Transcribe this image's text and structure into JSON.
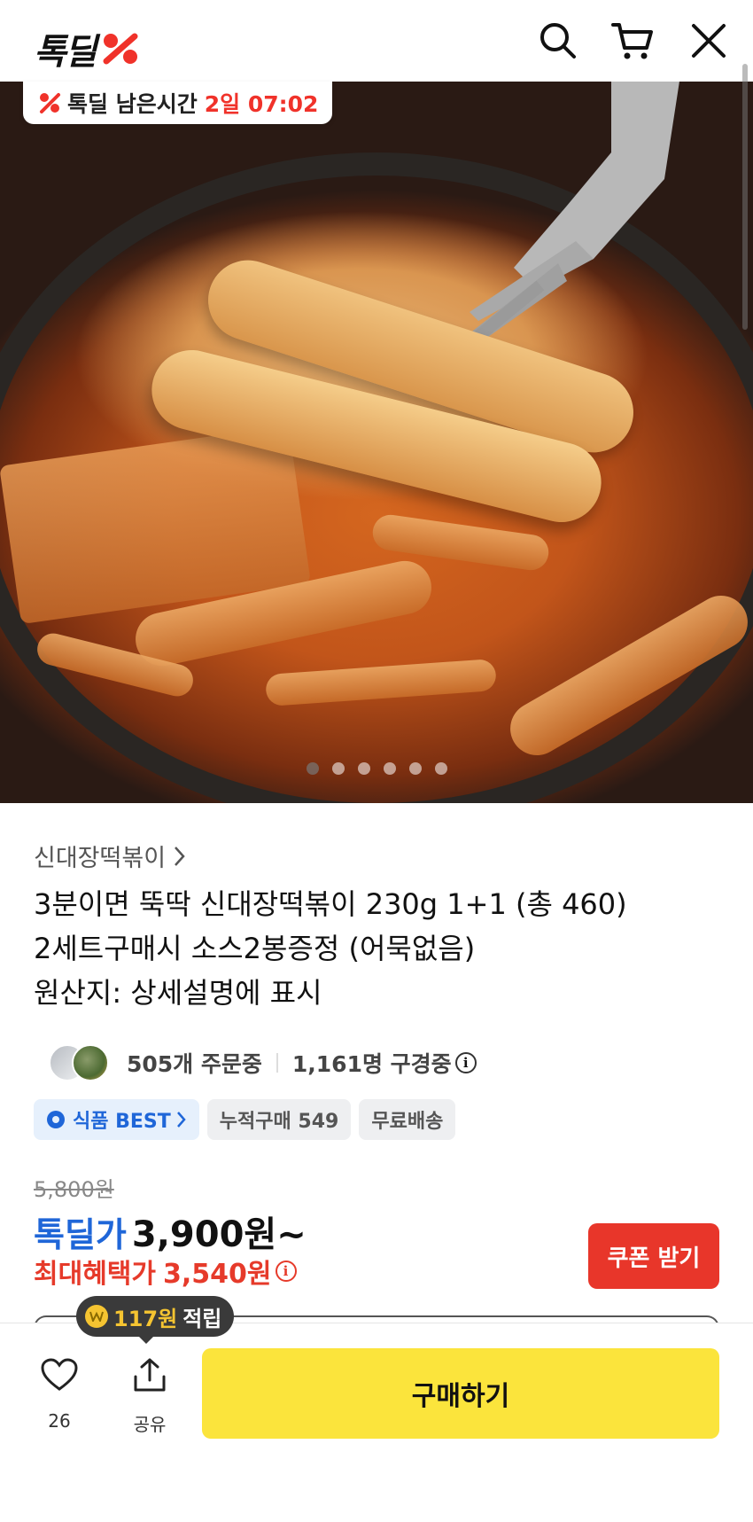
{
  "header": {
    "logo_text": "톡딜",
    "logo_mark": "discount-percent-mark",
    "search_icon": "search-icon",
    "cart_icon": "cart-icon",
    "close_icon": "close-icon"
  },
  "timer": {
    "label": "톡딜 남은시간",
    "value": "2일 07:02",
    "accent": "#f0322a"
  },
  "carousel": {
    "total": 6,
    "current": 1
  },
  "product": {
    "breadcrumb": "신대장떡볶이",
    "title_lines": [
      "3분이면 뚝딱 신대장떡볶이 230g 1+1 (총 460)",
      "2세트구매시 소스2봉증정 (어묵없음)",
      "원산지: 상세설명에 표시"
    ]
  },
  "social": {
    "orders": "505개 주문중",
    "viewers": "1,161명 구경중"
  },
  "badges": {
    "best": "식품 BEST",
    "cumulative": "누적구매 549",
    "shipping": "무료배송"
  },
  "price": {
    "original": "5,800원",
    "deal_label": "톡딜가",
    "deal_price": "3,900원~",
    "max_label": "최대혜택가",
    "max_price": "3,540원",
    "coupon_button": "쿠폰 받기",
    "deal_color": "#1f66d8",
    "max_color": "#e63a2a"
  },
  "tooltip": {
    "amount": "117원",
    "label": "적립"
  },
  "bottom_bar": {
    "like_count": "26",
    "share_label": "공유",
    "buy_button": "구매하기",
    "buy_color": "#fbe43c"
  }
}
